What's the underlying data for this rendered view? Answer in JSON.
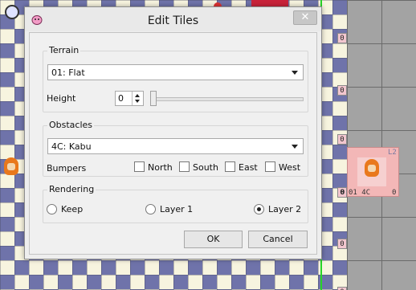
{
  "dialog": {
    "title": "Edit Tiles",
    "close_symbol": "✕"
  },
  "terrain": {
    "group_label": "Terrain",
    "selected": "01: Flat",
    "height_label": "Height",
    "height_value": "0",
    "height_slider_level": 0
  },
  "obstacles": {
    "group_label": "Obstacles",
    "selected": "4C: Kabu",
    "bumpers_label": "Bumpers",
    "bumpers": [
      {
        "label": "North",
        "checked": false
      },
      {
        "label": "South",
        "checked": false
      },
      {
        "label": "East",
        "checked": false
      },
      {
        "label": "West",
        "checked": false
      }
    ]
  },
  "rendering": {
    "group_label": "Rendering",
    "options": [
      {
        "label": "Keep",
        "selected": false
      },
      {
        "label": "Layer 1",
        "selected": false
      },
      {
        "label": "Layer 2",
        "selected": true
      }
    ]
  },
  "buttons": {
    "ok": "OK",
    "cancel": "Cancel"
  },
  "map": {
    "cell_markers": [
      "0",
      "0",
      "0",
      "0",
      "0",
      "0"
    ],
    "selected_tile": {
      "layer_tag": "L2",
      "info_left": "0",
      "info_mid": "01 4C",
      "info_right": "0"
    }
  },
  "icons": {
    "title_icon": "pink-creature-icon",
    "dropdown_arrow": "chevron-down-icon"
  },
  "colors": {
    "checker_dark": "#6f73aa",
    "checker_light": "#f7f4df",
    "selection": "#f3b7b7",
    "green_line": "#27d427"
  }
}
